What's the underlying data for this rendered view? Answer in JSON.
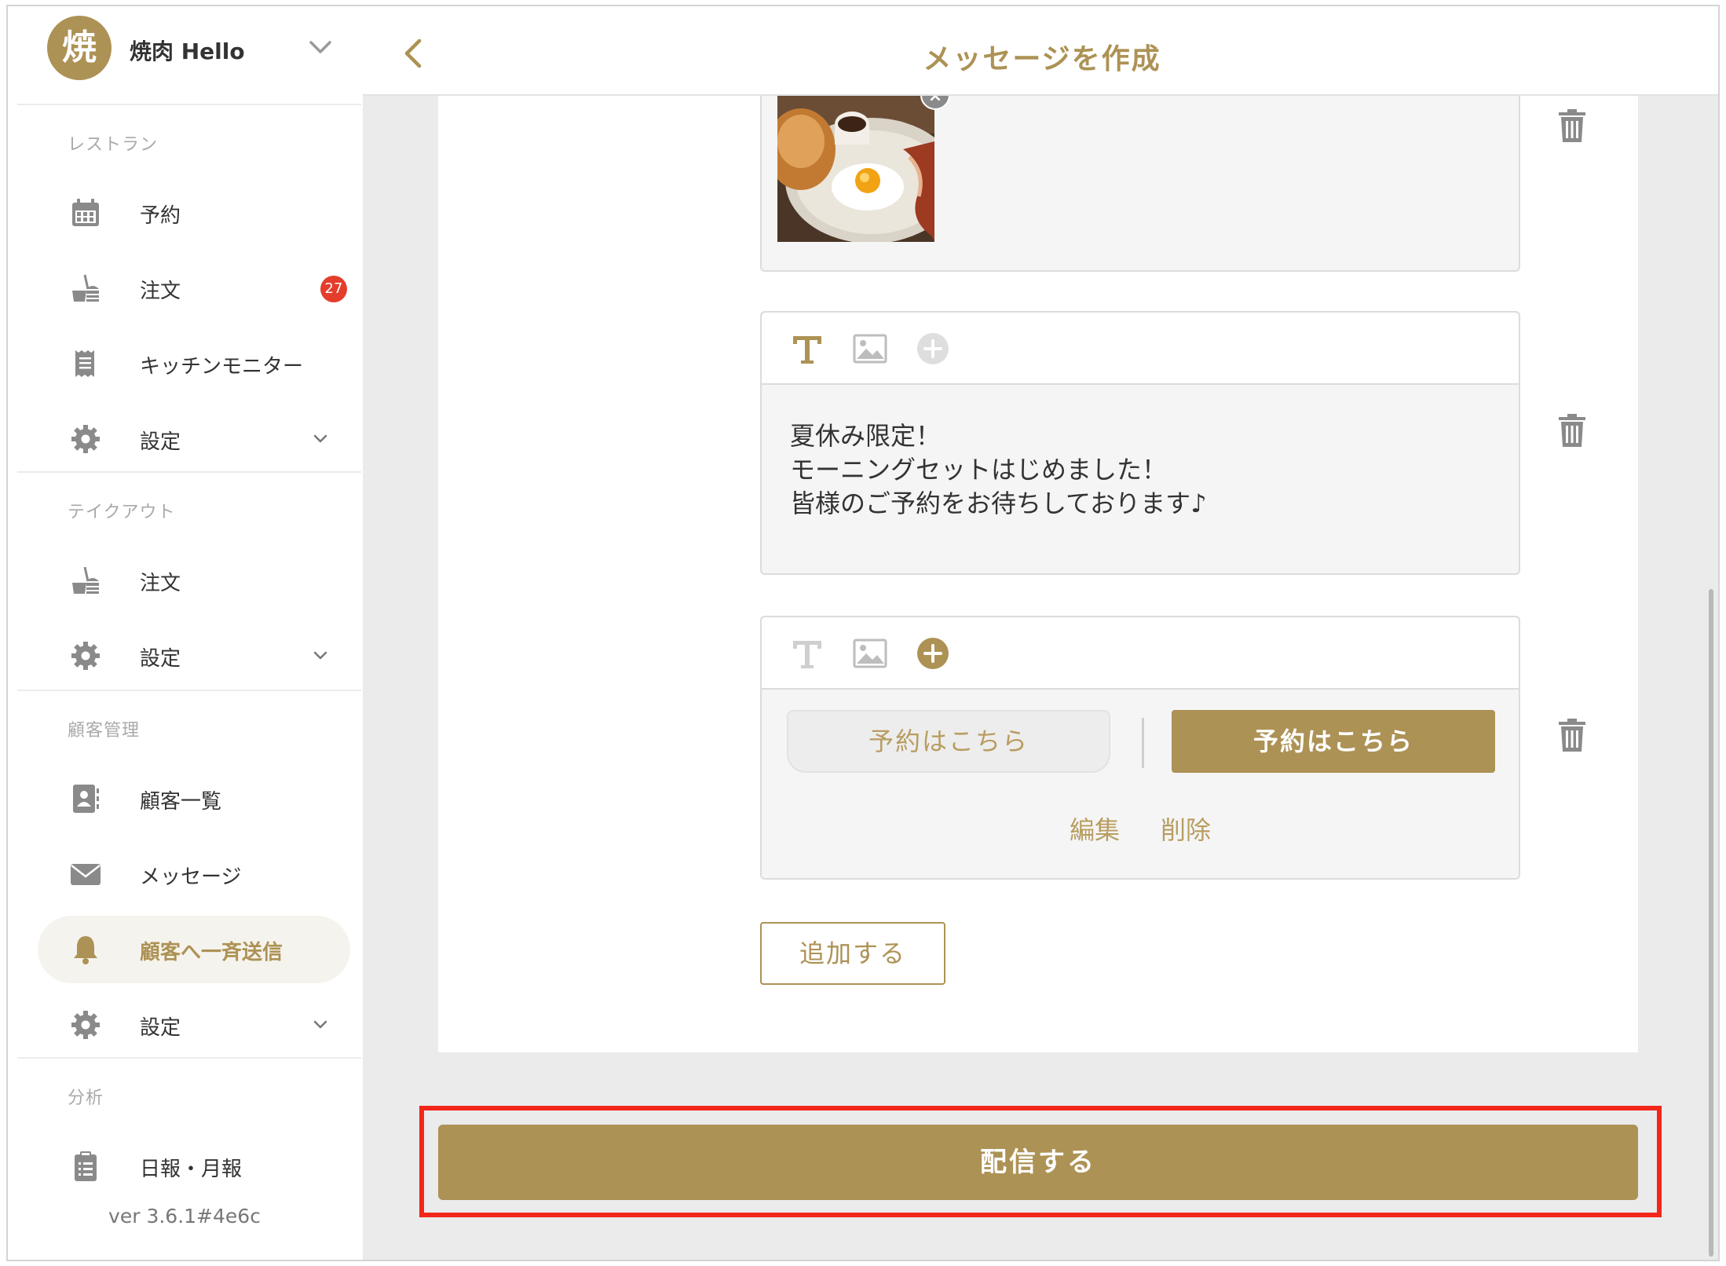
{
  "sidebar": {
    "avatar_char": "焼",
    "shop_name": "焼肉 Hello",
    "sections": {
      "restaurant": "レストラン",
      "takeout": "テイクアウト",
      "customers": "顧客管理",
      "analytics": "分析"
    },
    "items": [
      {
        "label": "予約",
        "icon": "calendar-icon"
      },
      {
        "label": "注文",
        "icon": "order-icon",
        "badge": "27"
      },
      {
        "label": "キッチンモニター",
        "icon": "receipt-icon"
      },
      {
        "label": "設定",
        "icon": "gear-icon"
      },
      {
        "label": "注文",
        "icon": "order-icon"
      },
      {
        "label": "設定",
        "icon": "gear-icon"
      },
      {
        "label": "顧客一覧",
        "icon": "contact-icon"
      },
      {
        "label": "メッセージ",
        "icon": "envelope-icon"
      },
      {
        "label": "顧客へ一斉送信",
        "icon": "bell-icon",
        "active": true
      },
      {
        "label": "設定",
        "icon": "gear-icon"
      },
      {
        "label": "日報・月報",
        "icon": "clipboard-icon"
      }
    ],
    "version": "ver 3.6.1#4e6c"
  },
  "header": {
    "title": "メッセージを作成"
  },
  "editor": {
    "text_message": "夏休み限定！\nモーニングセットはじめました！\n皆様のご予約をお待ちしております♪",
    "button_preview_light": "予約はこちら",
    "button_preview_dark": "予約はこちら",
    "edit_label": "編集",
    "delete_label": "削除",
    "add_label": "追加する",
    "image_close": "×"
  },
  "footer": {
    "send_label": "配信する"
  },
  "colors": {
    "accent": "#ad9255",
    "badge": "#e53d2c",
    "highlight": "#f2261a",
    "active_bg": "#f5f3ed"
  }
}
